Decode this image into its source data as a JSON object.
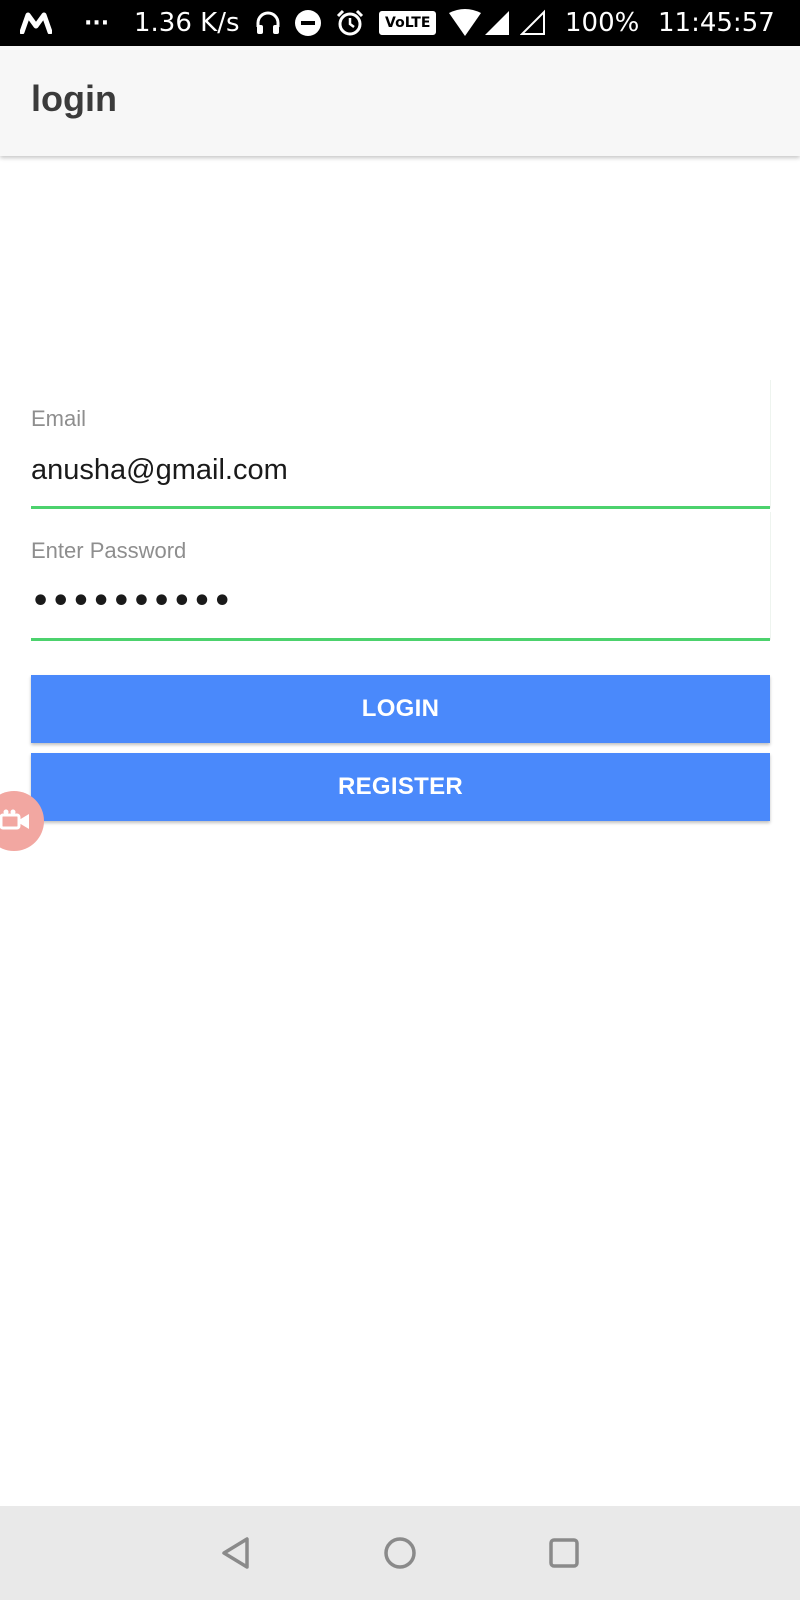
{
  "status_bar": {
    "carrier_glyph": "M",
    "overflow_dots": "···",
    "network_speed": "1.36 K/s",
    "volte_badge": "VoLTE",
    "battery": "100%",
    "clock": "11:45:57",
    "icons": [
      "carrier-icon",
      "more-icon",
      "headphones-icon",
      "dnd-icon",
      "alarm-icon",
      "volte-icon",
      "wifi-icon",
      "signal-icon",
      "signal-empty-icon"
    ]
  },
  "app_bar": {
    "title": "login"
  },
  "form": {
    "email": {
      "label": "Email",
      "value": "anusha@gmail.com"
    },
    "password": {
      "label": "Enter Password",
      "value": "••••••••••"
    },
    "login_label": "LOGIN",
    "register_label": "REGISTER"
  },
  "overlay": {
    "icon": "screen-recorder-icon"
  },
  "nav_bar": {
    "icons": [
      "back-icon",
      "home-icon",
      "recents-icon"
    ]
  },
  "colors": {
    "accent_button": "#4a89fb",
    "underline_active": "#4cd26d",
    "appbar_bg": "#f7f7f7",
    "status_bar_bg": "#000000",
    "nav_bar_bg": "#e9e9e9"
  }
}
